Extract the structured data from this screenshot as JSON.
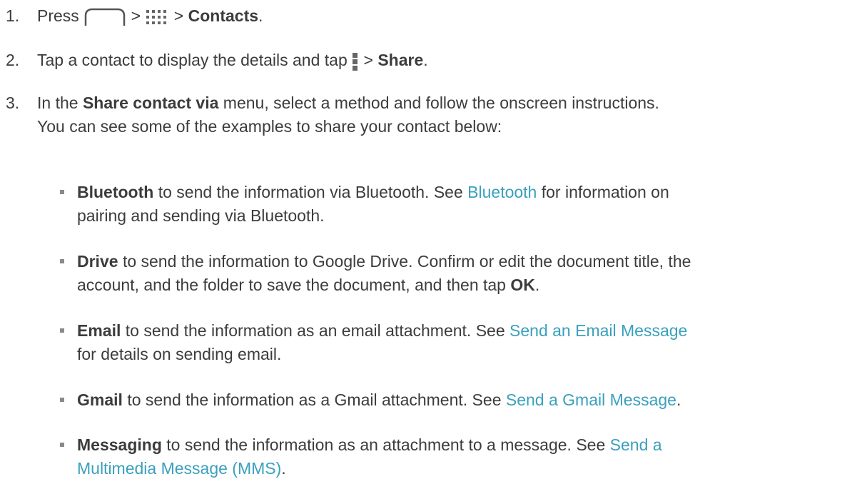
{
  "steps": [
    {
      "num": "1.",
      "press": "Press",
      "sep1": ">",
      "sep2": ">",
      "contacts": "Contacts",
      "end": "."
    },
    {
      "num": "2.",
      "t1": "Tap a contact to display the details and tap",
      "sep": ">",
      "share": "Share",
      "end": "."
    },
    {
      "num": "3.",
      "t1": "In the",
      "menu": "Share contact via",
      "t2": "menu, select a method and follow the onscreen instructions.",
      "line2": "You can see some of the examples to share your contact below:"
    }
  ],
  "bullets": [
    {
      "bold": "Bluetooth",
      "t1": "to send the information via Bluetooth. See",
      "link": "Bluetooth",
      "t2": "for information on",
      "line2": "pairing and sending via Bluetooth."
    },
    {
      "bold": "Drive",
      "t1": "to send the information to Google Drive. Confirm or edit the document title, the",
      "line2a": "account, and the folder to save the document, and then tap",
      "ok": "OK",
      "end": "."
    },
    {
      "bold": "Email",
      "t1": "to send the information as an email attachment. See",
      "link": "Send an Email Message",
      "line2": "for details on sending email."
    },
    {
      "bold": "Gmail",
      "t1": "to send the information as a Gmail attachment. See",
      "link": "Send a Gmail Message",
      "end": "."
    },
    {
      "bold": "Messaging",
      "t1": "to send the information as an attachment to a message. See",
      "link1": "Send a",
      "link2": "Multimedia Message (MMS)",
      "end": "."
    }
  ],
  "icons": {
    "home": "home-icon",
    "apps": "apps-grid-icon",
    "menu": "menu-icon"
  },
  "colors": {
    "text": "#3c3c3c",
    "link": "#3aa0bd",
    "bullet": "#8a8a8a"
  }
}
